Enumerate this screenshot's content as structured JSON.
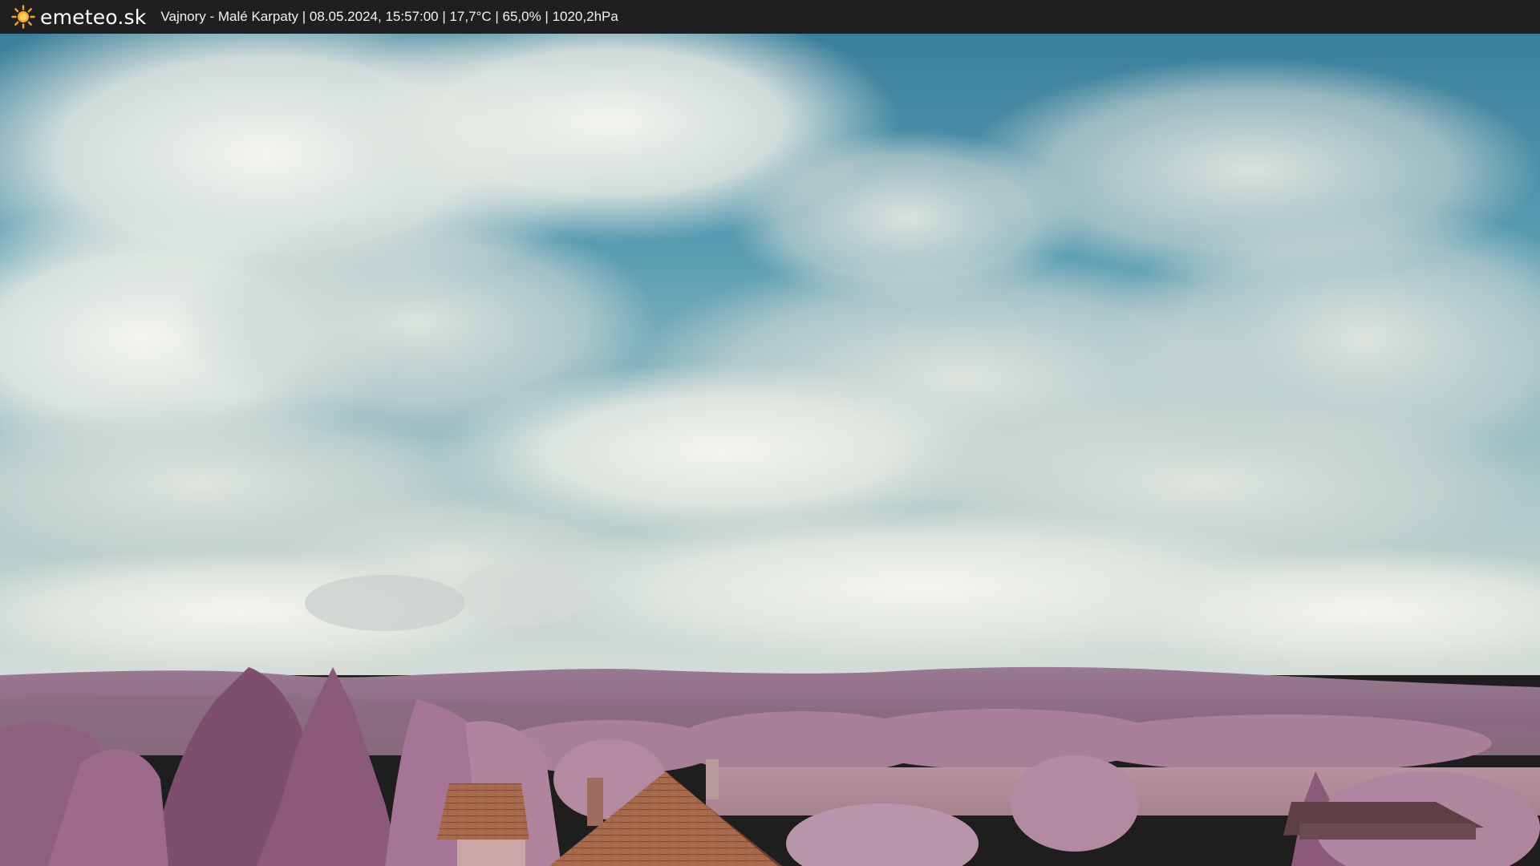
{
  "brand": {
    "name": "emeteo.sk",
    "icon": "sun-icon",
    "icon_color": "#f5a623"
  },
  "caption": {
    "text": "Vajnory - Malé Karpaty | 08.05.2024, 15:57:00 | 17,7°C | 65,0% | 1020,2hPa"
  },
  "colors": {
    "bar": "#1f1f1f",
    "sky_blue": "#3e8ea6",
    "cloud": "#e9ece6",
    "hills": "#8d6a84",
    "trees": "#a87595",
    "roof": "#a86a4c"
  }
}
